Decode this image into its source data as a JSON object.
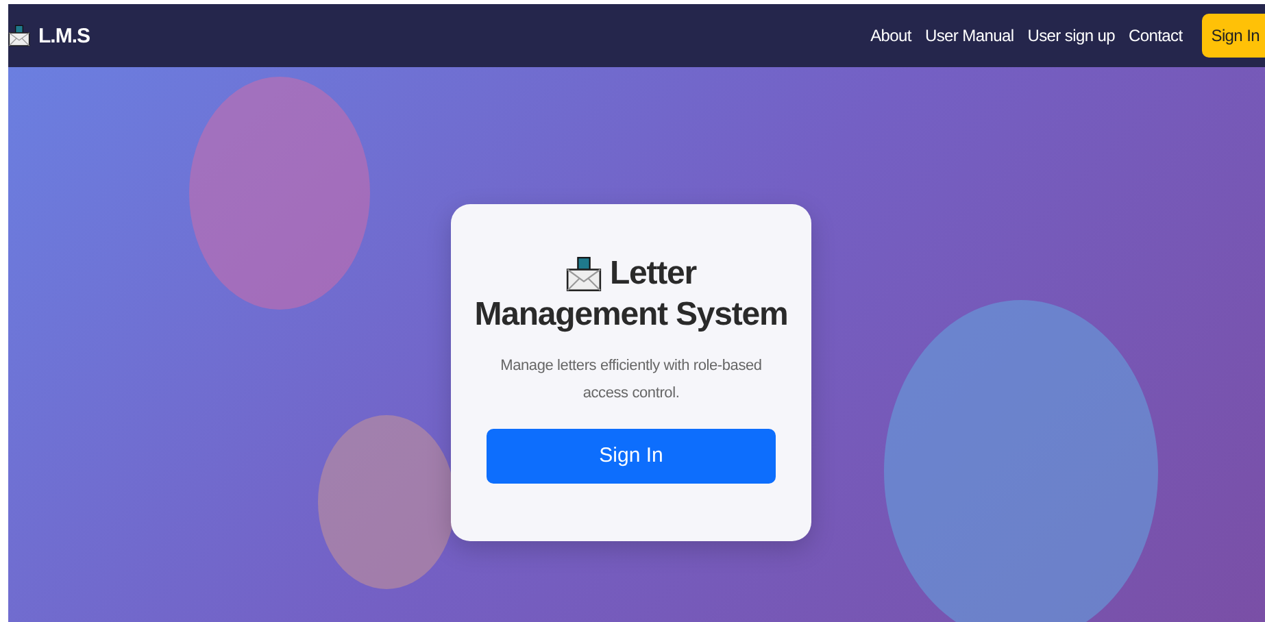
{
  "navbar": {
    "brand": "L.M.S",
    "links": [
      "About",
      "User Manual",
      "User sign up",
      "Contact"
    ],
    "action": "Sign In"
  },
  "card": {
    "title_line_1": "Letter",
    "title_line_2": "Management System",
    "description": "Manage letters efficiently with role-based access control.",
    "button": "Sign In"
  }
}
